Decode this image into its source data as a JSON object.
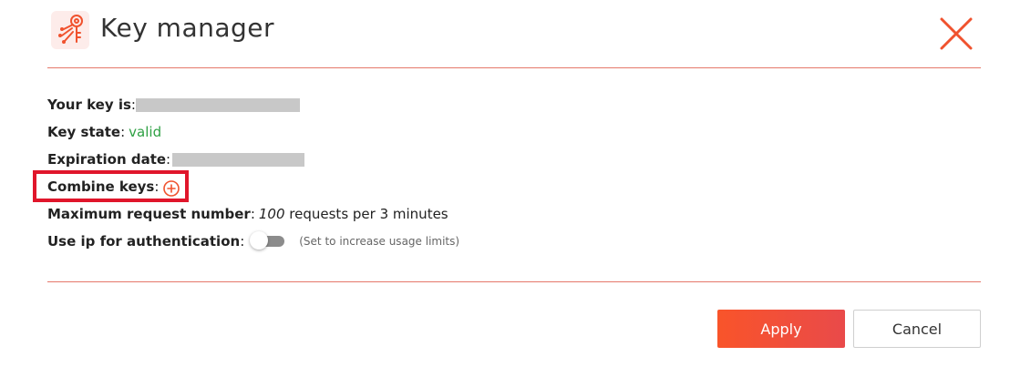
{
  "header": {
    "title": "Key manager",
    "logo_icon": "key-circuit-icon",
    "close_icon": "close-icon"
  },
  "fields": {
    "your_key": {
      "label": "Your key is",
      "colon": ":"
    },
    "key_state": {
      "label": "Key state",
      "colon": ":",
      "value": "valid"
    },
    "expiration": {
      "label": "Expiration date",
      "colon": ":"
    },
    "combine": {
      "label": "Combine keys",
      "colon": ":"
    },
    "max_requests": {
      "label": "Maximum request number",
      "colon": ":",
      "value": "100",
      "suffix": "requests per 3 minutes"
    },
    "use_ip": {
      "label": "Use ip for authentication",
      "colon": ":",
      "enabled": false,
      "hint": "(Set to increase usage limits)"
    }
  },
  "footer": {
    "apply_label": "Apply",
    "cancel_label": "Cancel"
  },
  "colors": {
    "accent": "#f9542a",
    "valid": "#2ea043",
    "highlight": "#e0162b"
  }
}
